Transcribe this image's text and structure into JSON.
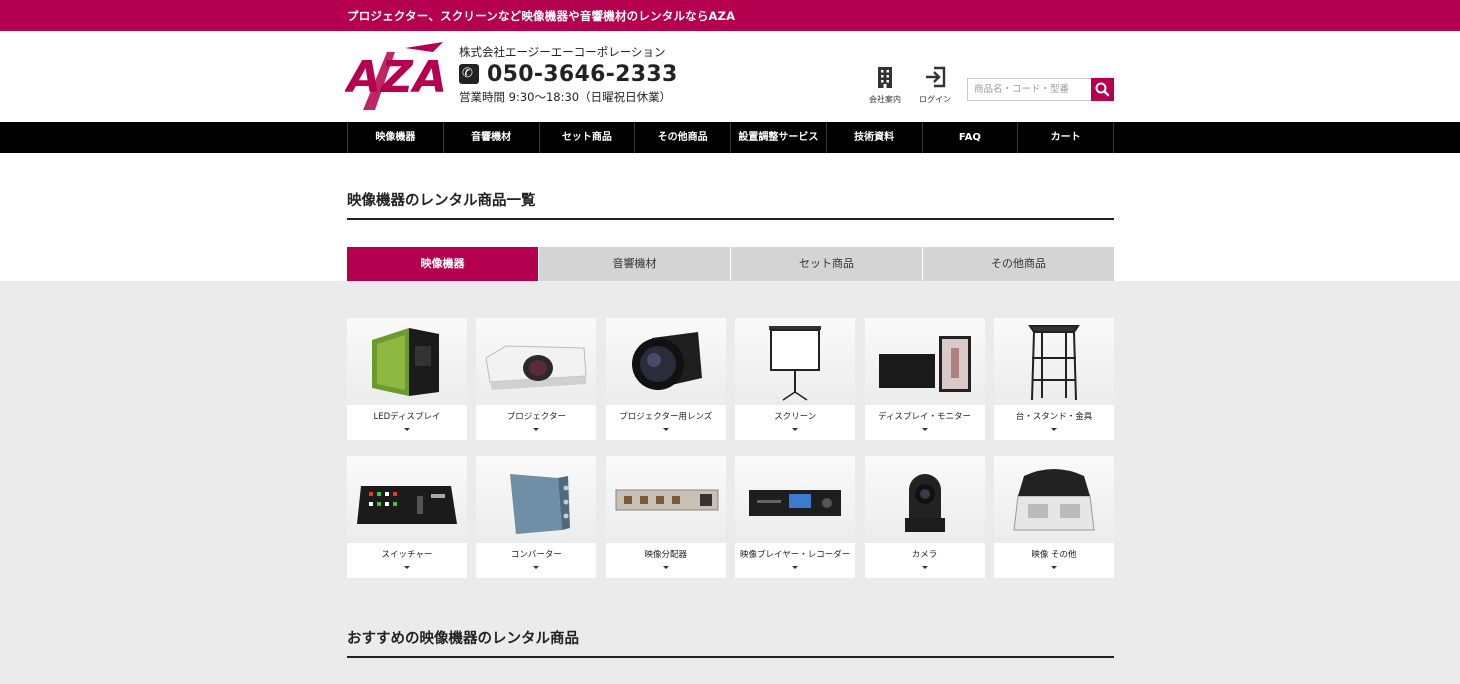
{
  "topbar": {
    "text": "プロジェクター、スクリーンなど映像機器や音響機材のレンタルならAZA"
  },
  "header": {
    "logo_text": "AZA",
    "company": "株式会社エージーエーコーポレーション",
    "phone": "050-3646-2333",
    "hours": "営業時間 9:30〜18:30（日曜祝日休業）",
    "links": [
      {
        "label": "会社案内",
        "icon": "building-icon"
      },
      {
        "label": "ログイン",
        "icon": "login-icon"
      }
    ],
    "search": {
      "placeholder": "商品名・コード・型番",
      "icon": "search-icon"
    }
  },
  "global_nav": [
    "映像機器",
    "音響機材",
    "セット商品",
    "その他商品",
    "設置調整サービス",
    "技術資料",
    "FAQ",
    "カート"
  ],
  "section_title": "映像機器のレンタル商品一覧",
  "tabs": [
    {
      "label": "映像機器",
      "active": true
    },
    {
      "label": "音響機材",
      "active": false
    },
    {
      "label": "セット商品",
      "active": false
    },
    {
      "label": "その他商品",
      "active": false
    }
  ],
  "categories": [
    {
      "label": "LEDディスプレイ",
      "icon": "led-display-icon"
    },
    {
      "label": "プロジェクター",
      "icon": "projector-icon"
    },
    {
      "label": "プロジェクター用レンズ",
      "icon": "lens-icon"
    },
    {
      "label": "スクリーン",
      "icon": "screen-icon"
    },
    {
      "label": "ディスプレイ・モニター",
      "icon": "monitor-icon"
    },
    {
      "label": "台・スタンド・金具",
      "icon": "stand-icon"
    },
    {
      "label": "スイッチャー",
      "icon": "switcher-icon"
    },
    {
      "label": "コンバーター",
      "icon": "converter-icon"
    },
    {
      "label": "映像分配器",
      "icon": "distributor-icon"
    },
    {
      "label": "映像プレイヤー・レコーダー",
      "icon": "player-recorder-icon"
    },
    {
      "label": "カメラ",
      "icon": "camera-icon"
    },
    {
      "label": "映像 その他",
      "icon": "vr-headset-icon"
    }
  ],
  "recommend_title": "おすすめの映像機器のレンタル商品",
  "colors": {
    "brand": "#b4004e",
    "nav_bg": "#000000",
    "tab_inactive": "#d4d4d4",
    "content_bg": "#ebebeb"
  }
}
